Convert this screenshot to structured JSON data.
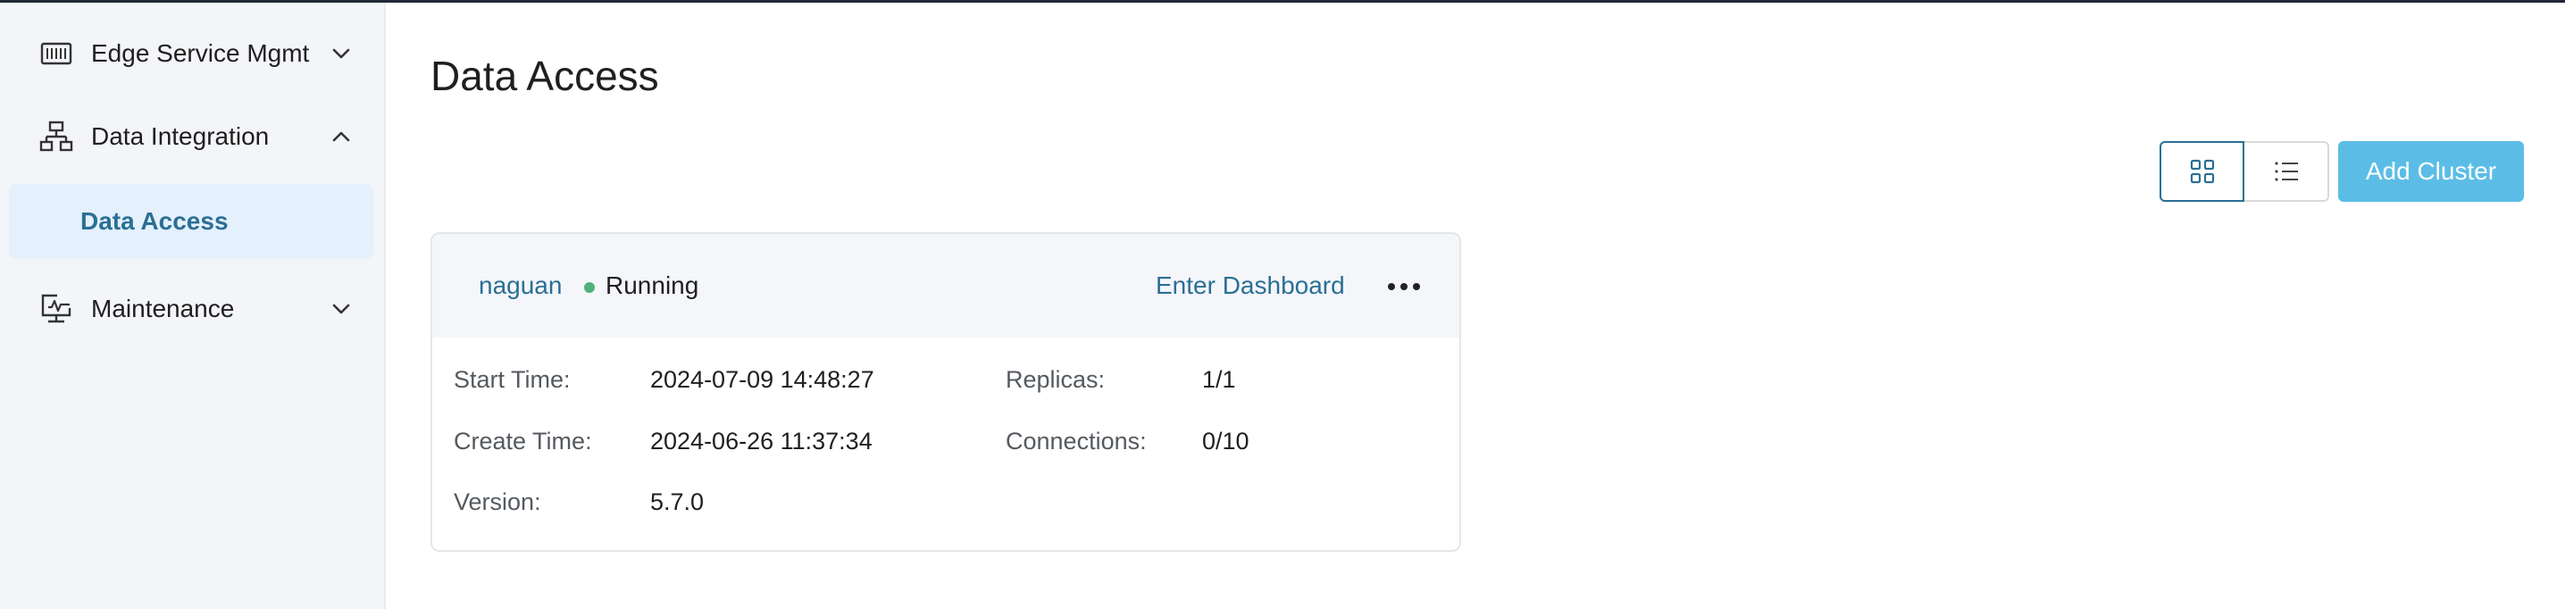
{
  "sidebar": {
    "items": [
      {
        "label": "Edge Service Mgmt",
        "icon": "barcode-icon",
        "expanded": false
      },
      {
        "label": "Data Integration",
        "icon": "sitemap-icon",
        "expanded": true
      },
      {
        "label": "Data Access",
        "icon": "",
        "active": true
      },
      {
        "label": "Maintenance",
        "icon": "monitor-pulse-icon",
        "expanded": false
      }
    ]
  },
  "page": {
    "title": "Data Access"
  },
  "toolbar": {
    "grid_view_icon": "grid-icon",
    "list_view_icon": "list-icon",
    "add_label": "Add Cluster"
  },
  "cluster": {
    "name": "naguan",
    "status": "Running",
    "status_color": "#52b07a",
    "enter_label": "Enter Dashboard",
    "more_icon": "more-icon",
    "fields": [
      {
        "label": "Start Time",
        "value": "2024-07-09 14:48:27"
      },
      {
        "label": "Replicas",
        "value": "1/1"
      },
      {
        "label": "Create Time",
        "value": "2024-06-26 11:37:34"
      },
      {
        "label": "Connections",
        "value": "0/10"
      },
      {
        "label": "Version",
        "value": "5.7.0"
      }
    ]
  },
  "colors": {
    "accent": "#2b6f94",
    "button": "#5bbde6",
    "sidebar_bg": "#f3f5f9",
    "active_item_bg": "#e4f0fb"
  }
}
